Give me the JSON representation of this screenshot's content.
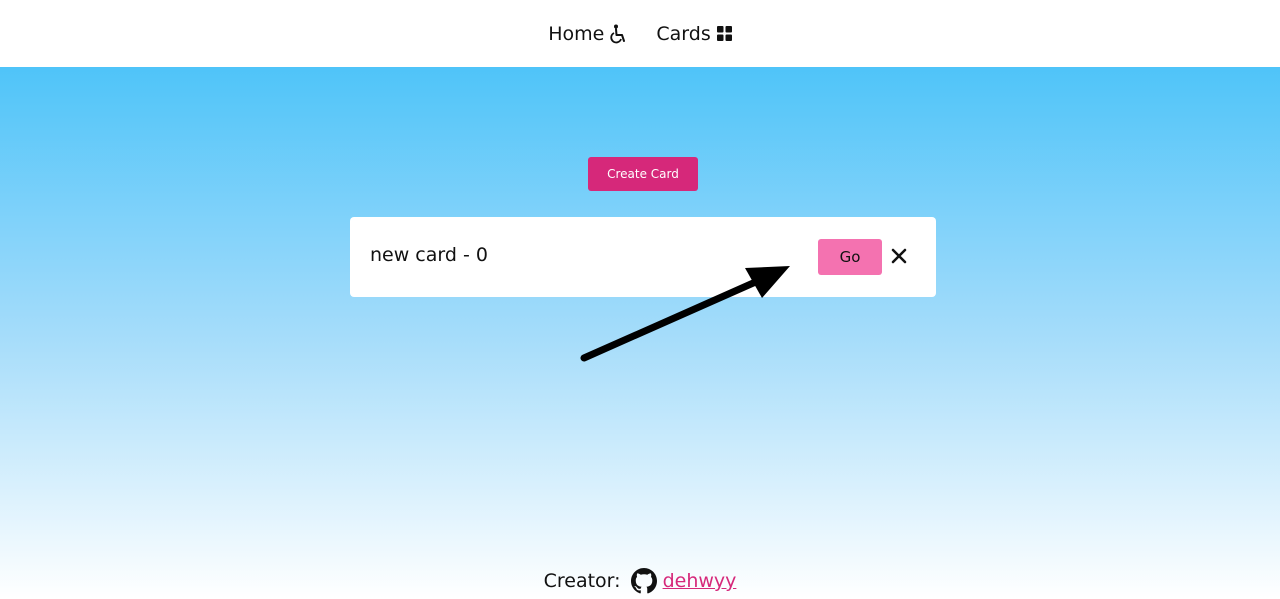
{
  "nav": {
    "home_label": "Home",
    "home_icon": "wheelchair-icon",
    "cards_label": "Cards",
    "cards_icon": "grid-icon"
  },
  "main": {
    "create_button_label": "Create Card",
    "card": {
      "title": "new card - 0",
      "go_label": "Go",
      "close_icon": "close-icon"
    }
  },
  "footer": {
    "creator_label": "Creator:",
    "github_icon": "github-icon",
    "username": " dehwyy"
  },
  "colors": {
    "accent": "#d6287a",
    "go_button": "#f472b0",
    "gradient_top": "#4fc4f9",
    "gradient_bottom": "#ffffff"
  }
}
